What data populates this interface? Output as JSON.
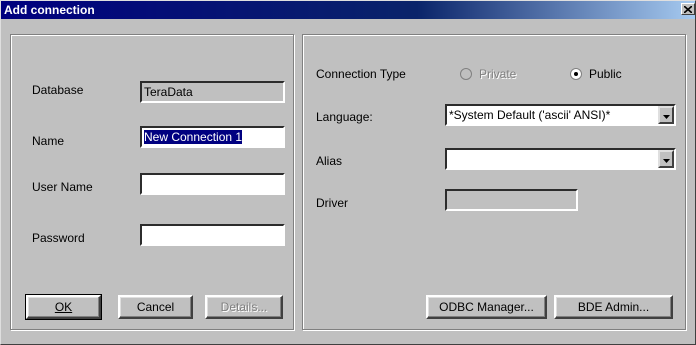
{
  "window": {
    "title": "Add connection"
  },
  "left_panel": {
    "database_label": "Database",
    "database_value": "TeraData",
    "name_label": "Name",
    "name_value": "New Connection 1",
    "username_label": "User Name",
    "username_value": "",
    "password_label": "Password",
    "password_value": ""
  },
  "right_panel": {
    "connection_type_label": "Connection Type",
    "radio_private_label": "Private",
    "radio_public_label": "Public",
    "selected_connection_type": "Public",
    "language_label": "Language:",
    "language_value": "*System Default ('ascii' ANSI)*",
    "alias_label": "Alias",
    "alias_value": "",
    "driver_label": "Driver",
    "driver_value": ""
  },
  "buttons": {
    "ok": "OK",
    "cancel": "Cancel",
    "details": "Details...",
    "odbc_manager": "ODBC Manager...",
    "bde_admin": "BDE Admin..."
  },
  "icons": {
    "close": "close-icon",
    "dropdown": "chevron-down-icon"
  },
  "colors": {
    "titlebar": "#00007f",
    "face": "#c0c0c0",
    "selection": "#000080"
  }
}
